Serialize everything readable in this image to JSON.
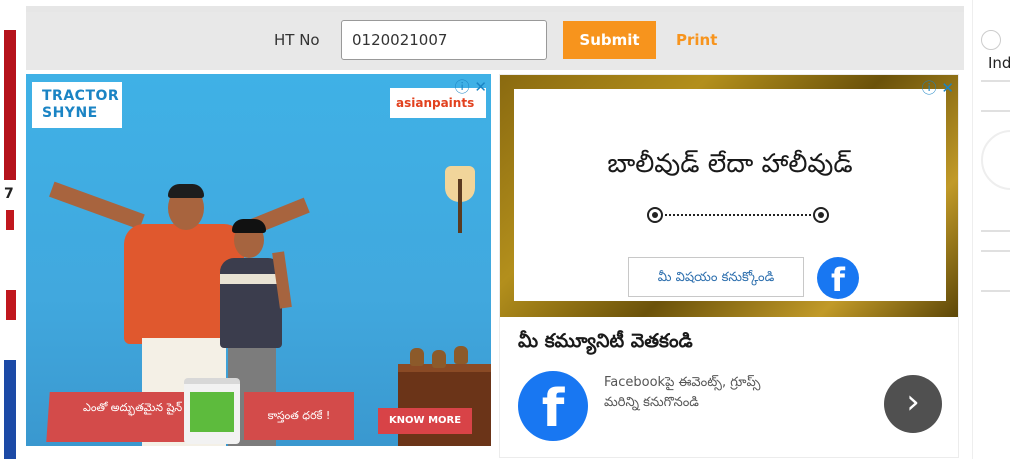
{
  "form": {
    "label": "HT No",
    "input_value": "0120021007",
    "submit_label": "Submit",
    "print_label": "Print"
  },
  "left_ad": {
    "logo_text": "TRACTOR SHYNE",
    "ad_choices_icon": "ⓘ ✕",
    "brand": "asianpaints",
    "banner_text": "ఎంతో అద్భుతమైన షైన్",
    "banner2_text": "కాస్తంత ధరకే !",
    "cta": "KNOW MORE"
  },
  "right_ad": {
    "ad_choices_icon": "ⓘ ✕",
    "headline": "బాలీవుడ్ లేదా హాలీవుడ్",
    "opinion_button": "మీ విషయం కనుక్కోండి",
    "community_title": "మీ కమ్యూనిటీ వెతకండి",
    "fb_description": "Facebookపై ఈవెంట్స్, గ్రూప్స్ మరిన్ని కనుగొనండి",
    "next_icon": "›",
    "fb_letter": "f"
  },
  "right_panel": {
    "text": "Ind"
  },
  "left_edge": {
    "digit": "7"
  }
}
